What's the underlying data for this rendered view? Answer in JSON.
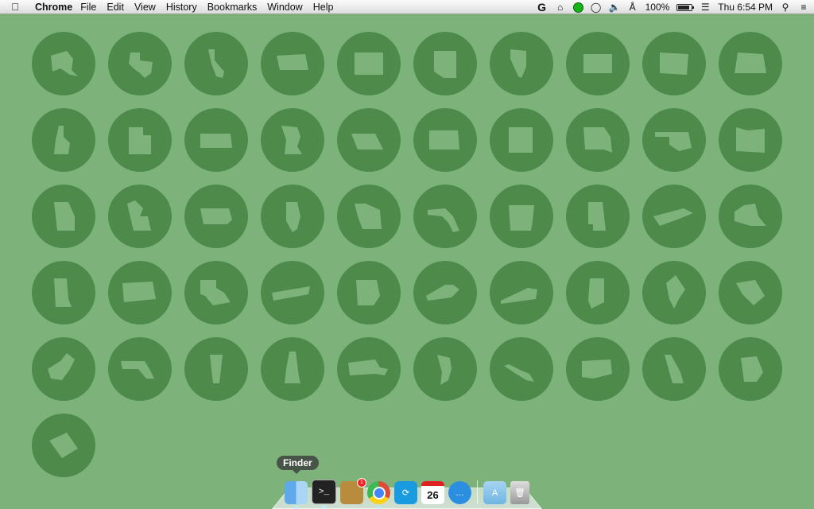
{
  "menubar": {
    "app_name": "Chrome",
    "menus": [
      "File",
      "Edit",
      "View",
      "History",
      "Bookmarks",
      "Window",
      "Help"
    ],
    "status": {
      "battery_text": "100%",
      "clock": "Thu 6:54 PM"
    }
  },
  "desktop": {
    "states": [
      "alaska",
      "texas",
      "california",
      "montana",
      "wyoming",
      "arizona",
      "nevada",
      "colorado",
      "north-dakota",
      "oregon",
      "idaho",
      "utah",
      "kansas",
      "minnesota",
      "nebraska",
      "south-dakota",
      "new-mexico",
      "missouri",
      "oklahoma",
      "washington",
      "georgia",
      "michigan",
      "iowa",
      "illinois",
      "wisconsin",
      "florida",
      "arkansas",
      "alabama",
      "north-carolina",
      "new-york",
      "mississippi",
      "pennsylvania",
      "louisiana",
      "tennessee",
      "ohio",
      "kentucky",
      "virginia",
      "indiana",
      "maine",
      "south-carolina",
      "west-virginia",
      "maryland",
      "vermont",
      "new-hampshire",
      "massachusetts",
      "new-jersey",
      "hawaii",
      "connecticut",
      "delaware",
      "rhode-island",
      "wyoming-alt"
    ]
  },
  "dock": {
    "tooltip": "Finder",
    "items": [
      {
        "name": "finder",
        "icon": "finder-icon"
      },
      {
        "name": "terminal",
        "icon": "terminal-icon",
        "text": ">_"
      },
      {
        "name": "mail",
        "icon": "mail-icon",
        "badge": "1"
      },
      {
        "name": "chrome",
        "icon": "chrome-icon"
      },
      {
        "name": "sync",
        "icon": "sync-icon"
      },
      {
        "name": "calendar",
        "icon": "calendar-icon",
        "text": "26"
      },
      {
        "name": "messages",
        "icon": "messages-icon"
      },
      {
        "name": "applications-folder",
        "icon": "folder-icon"
      },
      {
        "name": "trash",
        "icon": "trash-icon"
      }
    ]
  }
}
